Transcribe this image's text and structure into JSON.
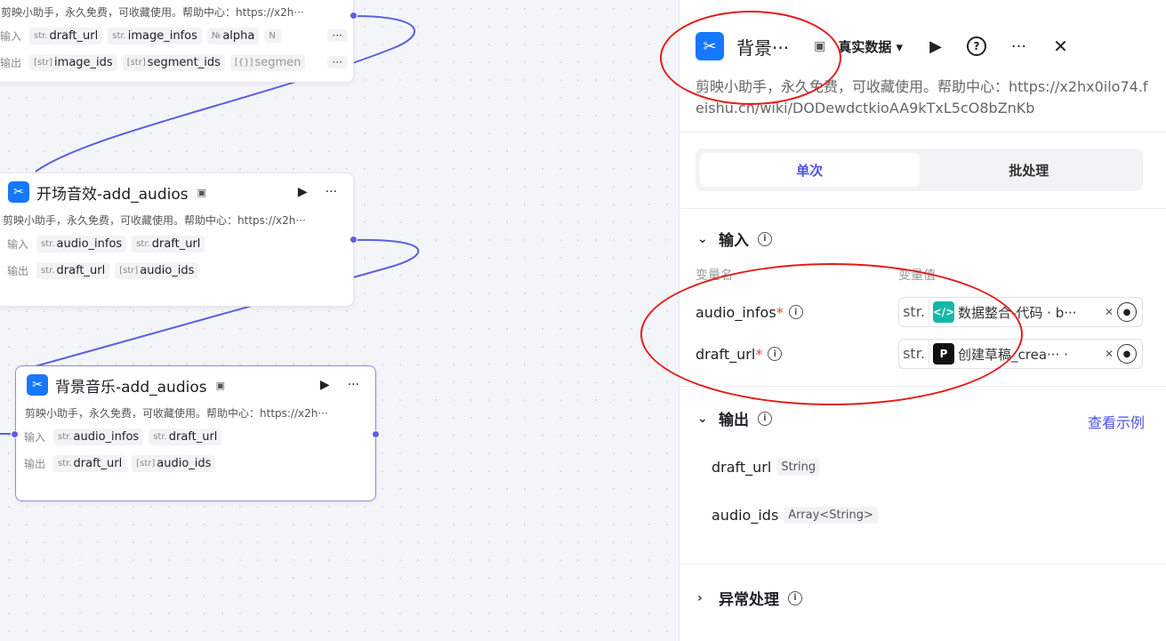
{
  "node_top": {
    "desc": "剪映小助手，永久免费，可收藏使用。帮助中心：https://x2h···",
    "input_label": "输入",
    "inputs": [
      {
        "type": "str.",
        "name": "draft_url"
      },
      {
        "type": "str.",
        "name": "image_infos"
      },
      {
        "type": "№",
        "name": "alpha"
      },
      {
        "type": "N",
        "name": ""
      }
    ],
    "output_label": "输出",
    "outputs": [
      {
        "type": "[str]",
        "name": "image_ids"
      },
      {
        "type": "[str]",
        "name": "segment_ids"
      },
      {
        "type": "[{}]",
        "name": "segmen"
      }
    ],
    "more": "···"
  },
  "node_mid": {
    "title": "开场音效-add_audios",
    "desc": "剪映小助手，永久免费，可收藏使用。帮助中心：https://x2h···",
    "input_label": "输入",
    "inputs": [
      {
        "type": "str.",
        "name": "audio_infos"
      },
      {
        "type": "str.",
        "name": "draft_url"
      }
    ],
    "output_label": "输出",
    "outputs": [
      {
        "type": "str.",
        "name": "draft_url"
      },
      {
        "type": "[str]",
        "name": "audio_ids"
      }
    ]
  },
  "node_bot": {
    "title": "背景音乐-add_audios",
    "desc": "剪映小助手，永久免费，可收藏使用。帮助中心：https://x2h···",
    "input_label": "输入",
    "inputs": [
      {
        "type": "str.",
        "name": "audio_infos"
      },
      {
        "type": "str.",
        "name": "draft_url"
      }
    ],
    "output_label": "输出",
    "outputs": [
      {
        "type": "str.",
        "name": "draft_url"
      },
      {
        "type": "[str]",
        "name": "audio_ids"
      }
    ]
  },
  "panel": {
    "title": "背景···",
    "data_mode": "真实数据 ▾",
    "desc": "剪映小助手，永久免费，可收藏使用。帮助中心：https://x2hx0ilo74.feishu.cn/wiki/DODewdctkioAA9kTxL5cO8bZnKb",
    "tabs": [
      "单次",
      "批处理"
    ],
    "input_section": "输入",
    "col_name": "变量名",
    "col_value": "变量值",
    "vars": [
      {
        "name": "audio_infos",
        "type": "str.",
        "ref": "数据整合-代码 · b···",
        "ref_color": "#14b8a6"
      },
      {
        "name": "draft_url",
        "type": "str.",
        "ref": "创建草稿_crea··· ·",
        "ref_color": "#111111"
      }
    ],
    "output_section": "输出",
    "view_example": "查看示例",
    "outputs": [
      {
        "name": "draft_url",
        "type": "String"
      },
      {
        "name": "audio_ids",
        "type": "Array<String>"
      }
    ],
    "error_section": "异常处理"
  },
  "colors": {
    "accent": "#4d53e8",
    "wire": "#5b5fe0",
    "annotation": "#e51b1b",
    "node_icon": "#1677ff"
  }
}
